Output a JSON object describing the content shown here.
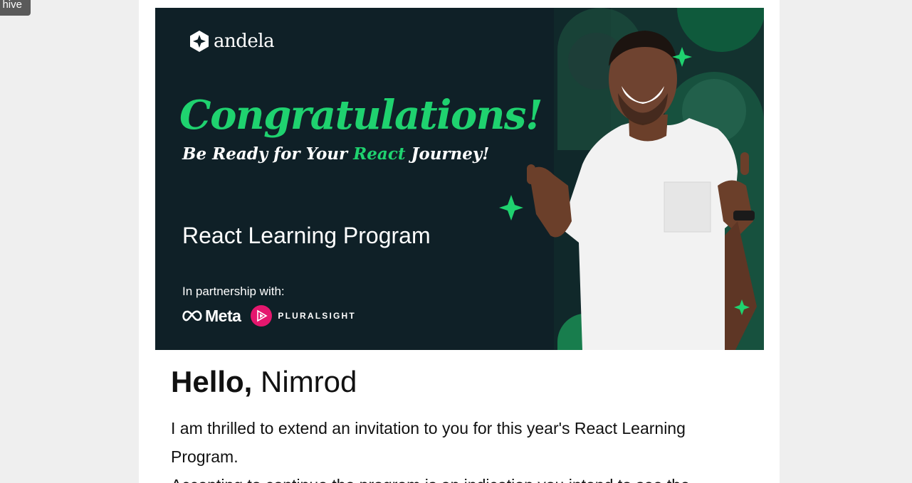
{
  "archive_tab": {
    "label": "hive"
  },
  "banner": {
    "brand": "andela",
    "congrats": "Congratulations!",
    "tagline_pre": "Be Ready for Your",
    "tagline_highlight": "React",
    "tagline_post": "Journey!",
    "program": "React Learning Program",
    "partner_label": "In partnership with:",
    "partner_meta": "Meta",
    "partner_pluralsight": "PLURALSIGHT",
    "colors": {
      "background": "#0f2027",
      "accent": "#1fd26f"
    }
  },
  "email": {
    "greeting_hello": "Hello,",
    "greeting_name": "Nimrod",
    "paragraph1": "I am thrilled to extend an invitation to you for this year's React Learning Program.",
    "paragraph2": "Accepting to continue the program is an indication you intend to see the"
  }
}
